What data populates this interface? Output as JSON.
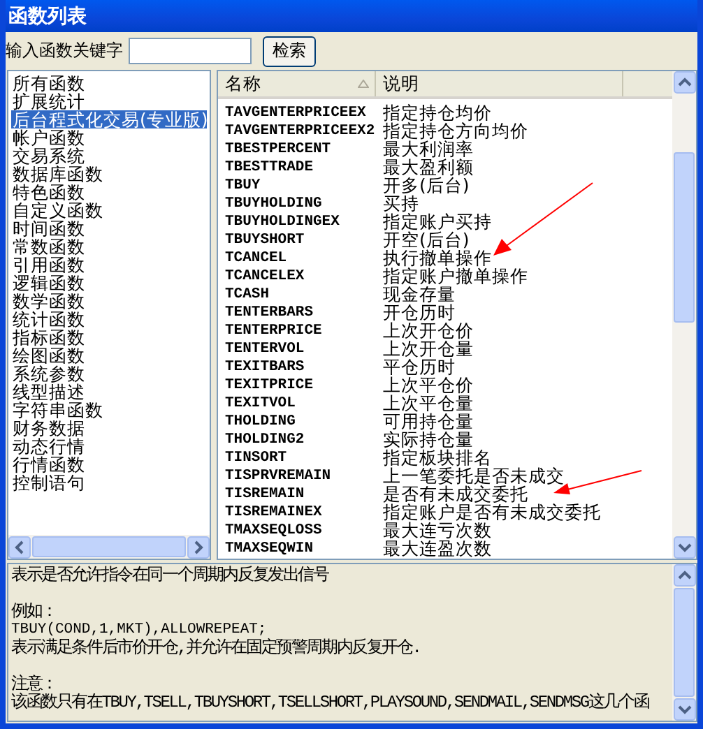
{
  "window": {
    "title": "函数列表"
  },
  "search": {
    "label": "输入函数关键字",
    "button": "检索"
  },
  "categories": [
    {
      "label": "所有函数",
      "selected": false
    },
    {
      "label": "扩展统计",
      "selected": false
    },
    {
      "label": "后台程式化交易(专业版)",
      "selected": true
    },
    {
      "label": "帐户函数",
      "selected": false
    },
    {
      "label": "交易系统",
      "selected": false
    },
    {
      "label": "数据库函数",
      "selected": false
    },
    {
      "label": "特色函数",
      "selected": false
    },
    {
      "label": "自定义函数",
      "selected": false
    },
    {
      "label": "时间函数",
      "selected": false
    },
    {
      "label": "常数函数",
      "selected": false
    },
    {
      "label": "引用函数",
      "selected": false
    },
    {
      "label": "逻辑函数",
      "selected": false
    },
    {
      "label": "数学函数",
      "selected": false
    },
    {
      "label": "统计函数",
      "selected": false
    },
    {
      "label": "指标函数",
      "selected": false
    },
    {
      "label": "绘图函数",
      "selected": false
    },
    {
      "label": "系统参数",
      "selected": false
    },
    {
      "label": "线型描述",
      "selected": false
    },
    {
      "label": "字符串函数",
      "selected": false
    },
    {
      "label": "财务数据",
      "selected": false
    },
    {
      "label": "动态行情",
      "selected": false
    },
    {
      "label": "行情函数",
      "selected": false
    },
    {
      "label": "控制语句",
      "selected": false
    }
  ],
  "table": {
    "columns": [
      "名称",
      "说明"
    ],
    "rows": [
      [
        "TAVGENTERPRICEEX",
        "指定持仓均价"
      ],
      [
        "TAVGENTERPRICEEX2",
        "指定持仓方向均价"
      ],
      [
        "TBESTPERCENT",
        "最大利润率"
      ],
      [
        "TBESTTRADE",
        "最大盈利额"
      ],
      [
        "TBUY",
        "开多(后台)"
      ],
      [
        "TBUYHOLDING",
        "买持"
      ],
      [
        "TBUYHOLDINGEX",
        "指定账户买持"
      ],
      [
        "TBUYSHORT",
        "开空(后台)"
      ],
      [
        "TCANCEL",
        "执行撤单操作"
      ],
      [
        "TCANCELEX",
        "指定账户撤单操作"
      ],
      [
        "TCASH",
        "现金存量"
      ],
      [
        "TENTERBARS",
        "开仓历时"
      ],
      [
        "TENTERPRICE",
        "上次开仓价"
      ],
      [
        "TENTERVOL",
        "上次开仓量"
      ],
      [
        "TEXITBARS",
        "平仓历时"
      ],
      [
        "TEXITPRICE",
        "上次平仓价"
      ],
      [
        "TEXITVOL",
        "上次平仓量"
      ],
      [
        "THOLDING",
        "可用持仓量"
      ],
      [
        "THOLDING2",
        "实际持仓量"
      ],
      [
        "TINSORT",
        "指定板块排名"
      ],
      [
        "TISPRVREMAIN",
        "上一笔委托是否未成交"
      ],
      [
        "TISREMAIN",
        "是否有未成交委托"
      ],
      [
        "TISREMAINEX",
        "指定账户是否有未成交委托"
      ],
      [
        "TMAXSEQLOSS",
        "最大连亏次数"
      ],
      [
        "TMAXSEQWIN",
        "最大连盈次数"
      ]
    ]
  },
  "description": [
    {
      "lines": [
        "表示是否允许指令在同一个周期内反复发出信号"
      ]
    },
    {
      "lines": [
        "例如：",
        "TBUY(COND,1,MKT),ALLOWREPEAT;",
        "表示满足条件后市价开仓,并允许在固定预警周期内反复开仓."
      ]
    },
    {
      "lines": [
        "注意：",
        "该函数只有在TBUY,TSELL,TBUYSHORT,TSELLSHORT,PLAYSOUND,SENDMAIL,SENDMSG这几个函"
      ]
    }
  ]
}
